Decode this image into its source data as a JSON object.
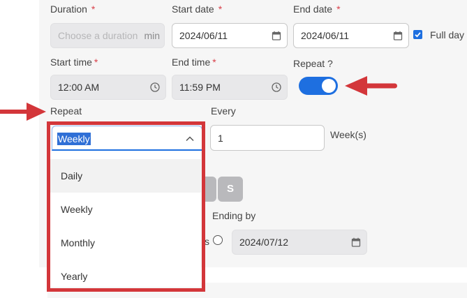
{
  "fields": {
    "duration": {
      "label": "Duration",
      "required": "*",
      "placeholder": "Choose a duration",
      "unit": "min"
    },
    "start_date": {
      "label": "Start date",
      "required": "*",
      "value": "2024/06/11",
      "icon": "calendar-icon"
    },
    "end_date": {
      "label": "End date",
      "required": "*",
      "value": "2024/06/11",
      "icon": "calendar-icon"
    },
    "full_day": {
      "label": "Full day",
      "checked": true
    },
    "start_time": {
      "label": "Start time",
      "required": "*",
      "value": "12:00 AM",
      "icon": "clock-icon"
    },
    "end_time": {
      "label": "End time",
      "required": "*",
      "value": "11:59 PM",
      "icon": "clock-icon"
    },
    "repeat_toggle": {
      "label": "Repeat ?",
      "on": true
    },
    "repeat": {
      "label": "Repeat",
      "value": "Weekly",
      "options": [
        "Daily",
        "Weekly",
        "Monthly",
        "Yearly"
      ]
    },
    "every": {
      "label": "Every",
      "value": "1",
      "unit": "Week(s)"
    },
    "weekday_visible": {
      "label": "S"
    },
    "ending_partial_label": "s",
    "ending_by": {
      "label": "Ending by",
      "value": "2024/07/12",
      "icon": "calendar-icon"
    }
  },
  "colors": {
    "accent": "#1e6fe0",
    "annotation": "#d3363a",
    "required": "#d9404a"
  }
}
